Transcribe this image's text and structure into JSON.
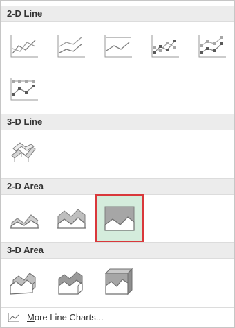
{
  "sections": [
    {
      "title": "2-D Line",
      "options": [
        {
          "name": "line-icon"
        },
        {
          "name": "stacked-line-icon"
        },
        {
          "name": "100-percent-stacked-line-icon"
        },
        {
          "name": "line-with-markers-icon"
        },
        {
          "name": "stacked-line-with-markers-icon"
        },
        {
          "name": "100-percent-stacked-line-with-markers-icon"
        }
      ]
    },
    {
      "title": "3-D Line",
      "options": [
        {
          "name": "3d-line-icon"
        }
      ]
    },
    {
      "title": "2-D Area",
      "options": [
        {
          "name": "area-icon"
        },
        {
          "name": "stacked-area-icon"
        },
        {
          "name": "100-percent-stacked-area-icon",
          "selected": true
        }
      ]
    },
    {
      "title": "3-D Area",
      "options": [
        {
          "name": "3d-area-icon"
        },
        {
          "name": "3d-stacked-area-icon"
        },
        {
          "name": "3d-100-percent-stacked-area-icon"
        }
      ]
    }
  ],
  "footer": {
    "label_first_letter": "M",
    "label_rest": "ore Line Charts...",
    "icon": "line-chart-icon"
  },
  "colors": {
    "selected_background": "#d4ecdc",
    "selected_border": "#d9383b",
    "header_background": "#ececec"
  }
}
